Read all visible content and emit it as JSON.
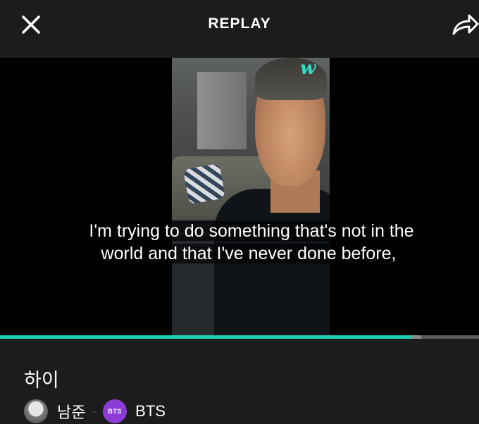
{
  "header": {
    "title": "REPLAY",
    "close_icon": "close-icon",
    "share_icon": "share-icon"
  },
  "player": {
    "logo_text": "w",
    "subtitle": "I'm trying to do something that's not in the world and that I've never done before,",
    "progress_played_fraction": 0.86,
    "progress_buffered_fraction": 0.88,
    "accent_color": "#1ecfb1"
  },
  "info": {
    "video_title": "하이",
    "creator_name": "남준",
    "channel_badge": "BTS",
    "channel_name": "BTS",
    "separator": "·"
  }
}
